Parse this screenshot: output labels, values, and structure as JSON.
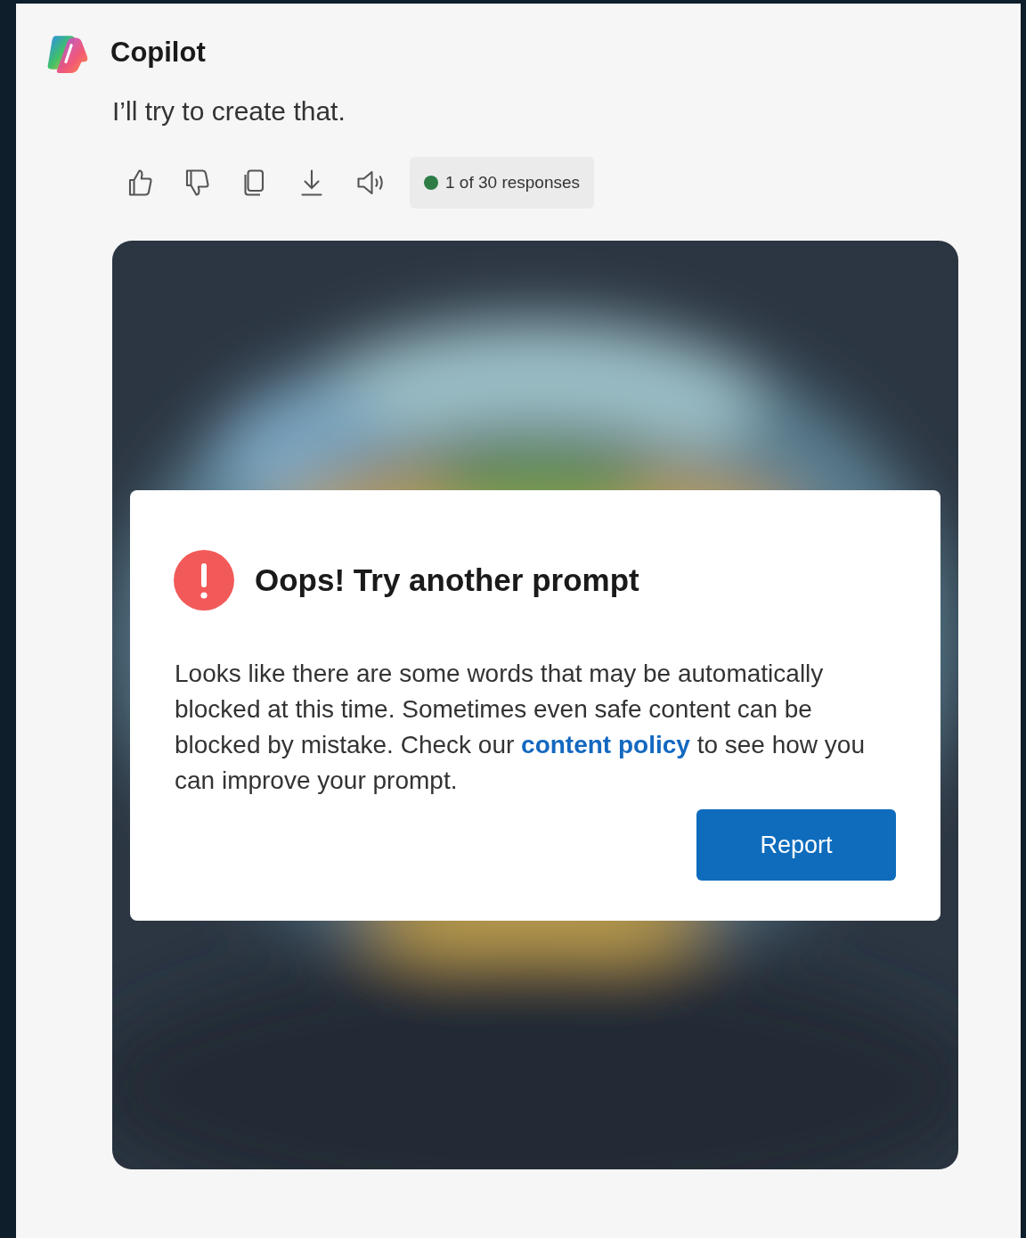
{
  "assistant": {
    "name": "Copilot"
  },
  "message": "I’ll try to create that.",
  "actions": [
    {
      "kind": "like"
    },
    {
      "kind": "dislike"
    },
    {
      "kind": "copy"
    },
    {
      "kind": "download"
    },
    {
      "kind": "speak"
    }
  ],
  "response_counter": {
    "text": "1 of 30 responses",
    "color": "#2e7d46"
  },
  "error_dialog": {
    "title": "Oops! Try another prompt",
    "text_before": "Looks like there are some words that may be automatically blocked at this time. Sometimes even safe content can be blocked by mistake. Check our ",
    "link": "content policy",
    "text_after": " to see how you can improve your prompt.",
    "button": "Report"
  }
}
